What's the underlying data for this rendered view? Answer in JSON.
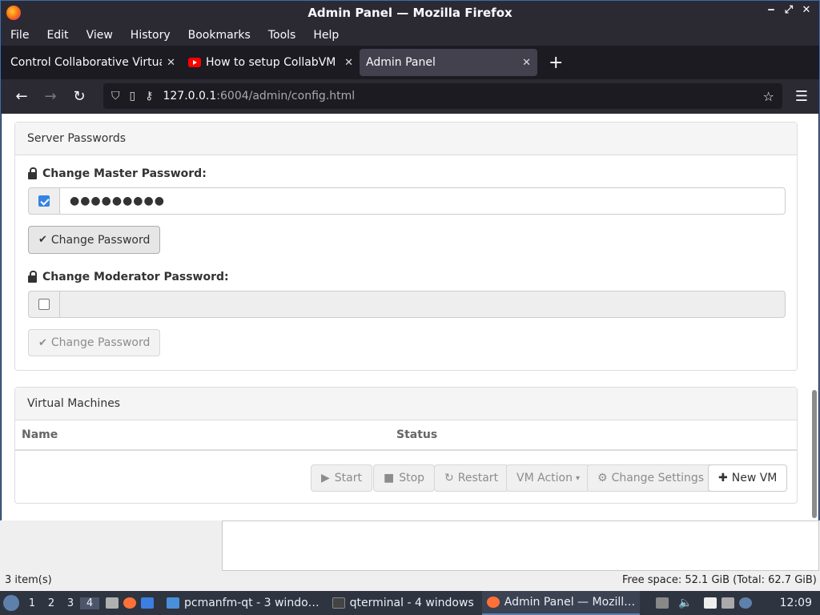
{
  "window": {
    "title": "Admin Panel — Mozilla Firefox",
    "controls": [
      "‒",
      "⤢",
      "✕"
    ]
  },
  "menubar": {
    "items": [
      "File",
      "Edit",
      "View",
      "History",
      "Bookmarks",
      "Tools",
      "Help"
    ]
  },
  "tabs": [
    {
      "label": "Control Collaborative Virtual",
      "active": false
    },
    {
      "label": "How to setup CollabVM S",
      "active": false
    },
    {
      "label": "Admin Panel",
      "active": true
    }
  ],
  "navbar": {
    "url_host": "127.0.0.1",
    "url_path": ":6004/admin/config.html"
  },
  "server_passwords": {
    "heading": "Server Passwords",
    "master_label": "Change Master Password:",
    "master_value": "●●●●●●●●●",
    "master_checked": true,
    "master_button": "Change Password",
    "moderator_label": "Change Moderator Password:",
    "moderator_value": "",
    "moderator_checked": false,
    "moderator_button": "Change Password"
  },
  "virtual_machines": {
    "heading": "Virtual Machines",
    "columns": [
      "Name",
      "Status"
    ],
    "actions": {
      "start": "Start",
      "stop": "Stop",
      "restart": "Restart",
      "vm_action": "VM Action",
      "change_settings": "Change Settings",
      "new_vm": "New VM"
    }
  },
  "file_manager": {
    "items_count": "3 item(s)",
    "free_space": "Free space: 52.1 GiB (Total: 62.7 GiB)"
  },
  "taskbar": {
    "workspaces": [
      "1",
      "2",
      "3",
      "4"
    ],
    "tasks": [
      {
        "label": "pcmanfm-qt - 3 windo…",
        "active": false
      },
      {
        "label": "qterminal - 4 windows",
        "active": false
      },
      {
        "label": "Admin Panel — Mozill…",
        "active": true
      }
    ],
    "clock": "12:09"
  }
}
